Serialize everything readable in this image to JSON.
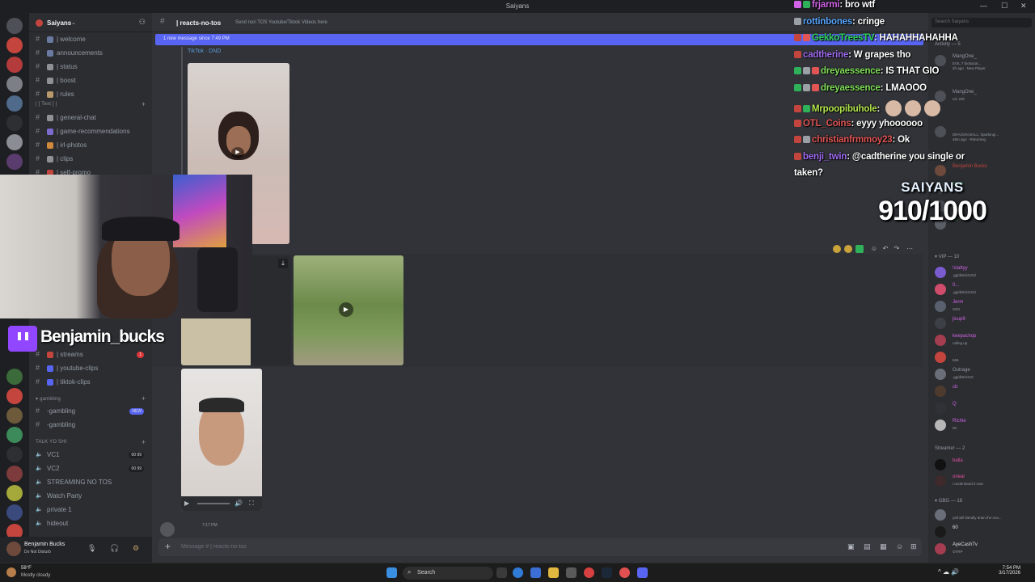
{
  "window": {
    "title": "Saiyans"
  },
  "server": {
    "name": "Saiyans"
  },
  "channels_top": [
    {
      "label": "| welcome",
      "color": "#6b7aa0"
    },
    {
      "label": "announcements",
      "color": "#6b7aa0"
    },
    {
      "label": "| status",
      "color": "#8e9297"
    },
    {
      "label": "| boost",
      "color": "#8e9297"
    },
    {
      "label": "| rules",
      "color": "#b89a6a"
    }
  ],
  "category_text": "| [ Text ] |",
  "channels_text": [
    {
      "label": "| general-chat",
      "color": "#8e9297"
    },
    {
      "label": "| game-recommendations",
      "color": "#7d6bd0"
    },
    {
      "label": "| irl-photos",
      "color": "#d08a3c"
    },
    {
      "label": "| clips",
      "color": "#8e9297"
    },
    {
      "label": "| self-promo",
      "color": "#c4453d"
    }
  ],
  "channels_stream": [
    {
      "label": "| streams",
      "color": "#c4453d",
      "badge": "1"
    },
    {
      "label": "| youtube-clips",
      "color": "#5865f2"
    },
    {
      "label": "| tiktok-clips",
      "color": "#5865f2"
    }
  ],
  "category_gambling": "gambling",
  "channels_gambling": [
    {
      "label": "-gambling",
      "pill": "NEW"
    },
    {
      "label": "-gambling"
    }
  ],
  "category_voice": "TALK YO SHI",
  "voice_channels": [
    {
      "label": "VC1",
      "pill": "00 99"
    },
    {
      "label": "VC2",
      "pill": "00 99"
    },
    {
      "label": "STREAMING NO TOS"
    },
    {
      "label": "Watch Party"
    },
    {
      "label": "private 1"
    },
    {
      "label": "hideout"
    }
  ],
  "user": {
    "name": "Benjamin Bucks",
    "status": "Do Not Disturb"
  },
  "channel_header": {
    "name": "| reacts-no-tos",
    "topic": "Send non TOS Youtube/Tiktok Videos here"
  },
  "new_messages_bar": "1 new message since 7:49 PM",
  "message": {
    "embed_label": "TikTok · DND",
    "time": "7:17 PM"
  },
  "composer": {
    "placeholder": "Message # | reacts-no-tos"
  },
  "members": {
    "search_placeholder": "Search Saiyans",
    "activity_header": "Activity — 5",
    "activity": [
      {
        "name": "MangOne_",
        "sub": "EVIL 7 biohazar...",
        "sub2": "2h ago · New Player",
        "color": "#949ba4"
      },
      {
        "name": "MangOne_",
        "sub": "ed: 20h",
        "color": "#949ba4"
      },
      {
        "name": "",
        "sub": "DRAGON BALL: Sparking!...",
        "sub2": "48m ago · Returning",
        "color": "#949ba4"
      }
    ],
    "list": [
      {
        "name": "Benjamin Bucks",
        "color": "#c4453d",
        "avatar": "#6d4a3b"
      },
      {
        "name": "crtch",
        "color": "#2fb15a",
        "avatar": "#3a3d44"
      },
      {
        "name": "",
        "color": "#2fb15a",
        "avatar": "#4a4d55"
      },
      {
        "name": "zb",
        "color": "#2fb15a",
        "avatar": "#5a5e66"
      }
    ],
    "vip_header": "VIP — 10",
    "vip": [
      {
        "name": "!slattyy",
        "sub": ".gg/district10xl",
        "color": "#d063e6",
        "avatar": "#7a5bd0"
      },
      {
        "name": "0...",
        "sub": ".gg/district10xl",
        "color": "#d063e6",
        "avatar": "#d04c6b"
      },
      {
        "name": "Jerm",
        "sub": "SSG",
        "color": "#d063e6",
        "avatar": "#59616e"
      },
      {
        "name": "jixup9",
        "sub": "",
        "color": "#d063e6",
        "avatar": "#3d3f46"
      },
      {
        "name": "keepachop",
        "sub": "rolling up",
        "color": "#d063e6",
        "avatar": "#a33d4f"
      },
      {
        "name": "",
        "sub": "666",
        "color": "#d063e6",
        "avatar": "#c4453d"
      },
      {
        "name": "Outrage",
        "sub": ".gg/district10",
        "color": "#949ba4",
        "avatar": "#6a6e78"
      },
      {
        "name": "cb",
        "sub": "",
        "color": "#d063e6",
        "avatar": "#4f3b2e"
      },
      {
        "name": "Q",
        "sub": "",
        "color": "#d063e6",
        "avatar": "#2f3136"
      },
      {
        "name": "Richie",
        "sub": "00",
        "color": "#d063e6",
        "avatar": "#b7b7b7"
      }
    ],
    "streamer_header": "Streamer — 2",
    "streamers": [
      {
        "name": "balla",
        "sub": "",
        "color": "#e44ea1",
        "avatar": "#111"
      },
      {
        "name": "oneal",
        "sub": "i understand it now",
        "color": "#e44ea1",
        "avatar": "#3e2a2a"
      }
    ],
    "gbg_header": "GBG — 18",
    "gbg": [
      {
        "name": "",
        "sub": "yall will literally drain the nca...",
        "color": "#d063e6",
        "avatar": "#6a6e78"
      },
      {
        "name": "60",
        "sub": "",
        "color": "#dbdee1",
        "avatar": "#1a1a1a"
      },
      {
        "name": "AyeCashTv",
        "sub": "OTRP",
        "color": "#dbdee1",
        "avatar": "#a33d4f"
      }
    ]
  },
  "overlay_chat": [
    {
      "user": "frjarmi",
      "msg": "bro wtf",
      "color": "#d063e6",
      "icons": [
        "#d063e6",
        "#2fb15a"
      ]
    },
    {
      "user": "rottinbones",
      "msg": "cringe",
      "color": "#58a6ff",
      "icons": [
        "#9aa0a6"
      ]
    },
    {
      "user": "GekkoTreesTV",
      "msg": "HAHAHHAHAHHA",
      "color": "#2fd35a",
      "icons": [
        "#c4453d",
        "#e25555"
      ]
    },
    {
      "user": "cadtherine",
      "msg": "W grapes tho",
      "color": "#a06cf0",
      "icons": [
        "#c4453d"
      ]
    },
    {
      "user": "dreyaessence",
      "msg": "IS THAT GIO",
      "color": "#80e05a",
      "icons": [
        "#2fb15a",
        "#9aa0a6",
        "#e25555"
      ]
    },
    {
      "user": "dreyaessence",
      "msg": "LMAOOO",
      "color": "#80e05a",
      "icons": [
        "#2fb15a",
        "#9aa0a6",
        "#e25555"
      ]
    },
    {
      "user": "Mrpoopibuhole",
      "msg": "",
      "color": "#b3e64e",
      "icons": [
        "#c4453d",
        "#2fb15a"
      ]
    },
    {
      "user": "OTL_Coins",
      "msg": "eyyy yhoooooo",
      "color": "#e25555",
      "icons": [
        "#c4453d"
      ]
    },
    {
      "user": "christianfrmmoy23",
      "msg": "Ok",
      "color": "#e25555",
      "icons": [
        "#c4453d",
        "#9aa0a6"
      ]
    },
    {
      "user": "benji_twin",
      "msg": "@cadtherine you single or",
      "color": "#a06cf0",
      "icons": [
        "#c4453d"
      ],
      "cont": "taken?"
    }
  ],
  "goal": {
    "title": "SAIYANS",
    "value": "910/1000"
  },
  "streamer_tag": "Benjamin_bucks",
  "taskbar": {
    "temp": "58°F",
    "weather": "Mostly cloudy",
    "search": "Search",
    "time": "7:54 PM",
    "date": "3/17/2026"
  }
}
